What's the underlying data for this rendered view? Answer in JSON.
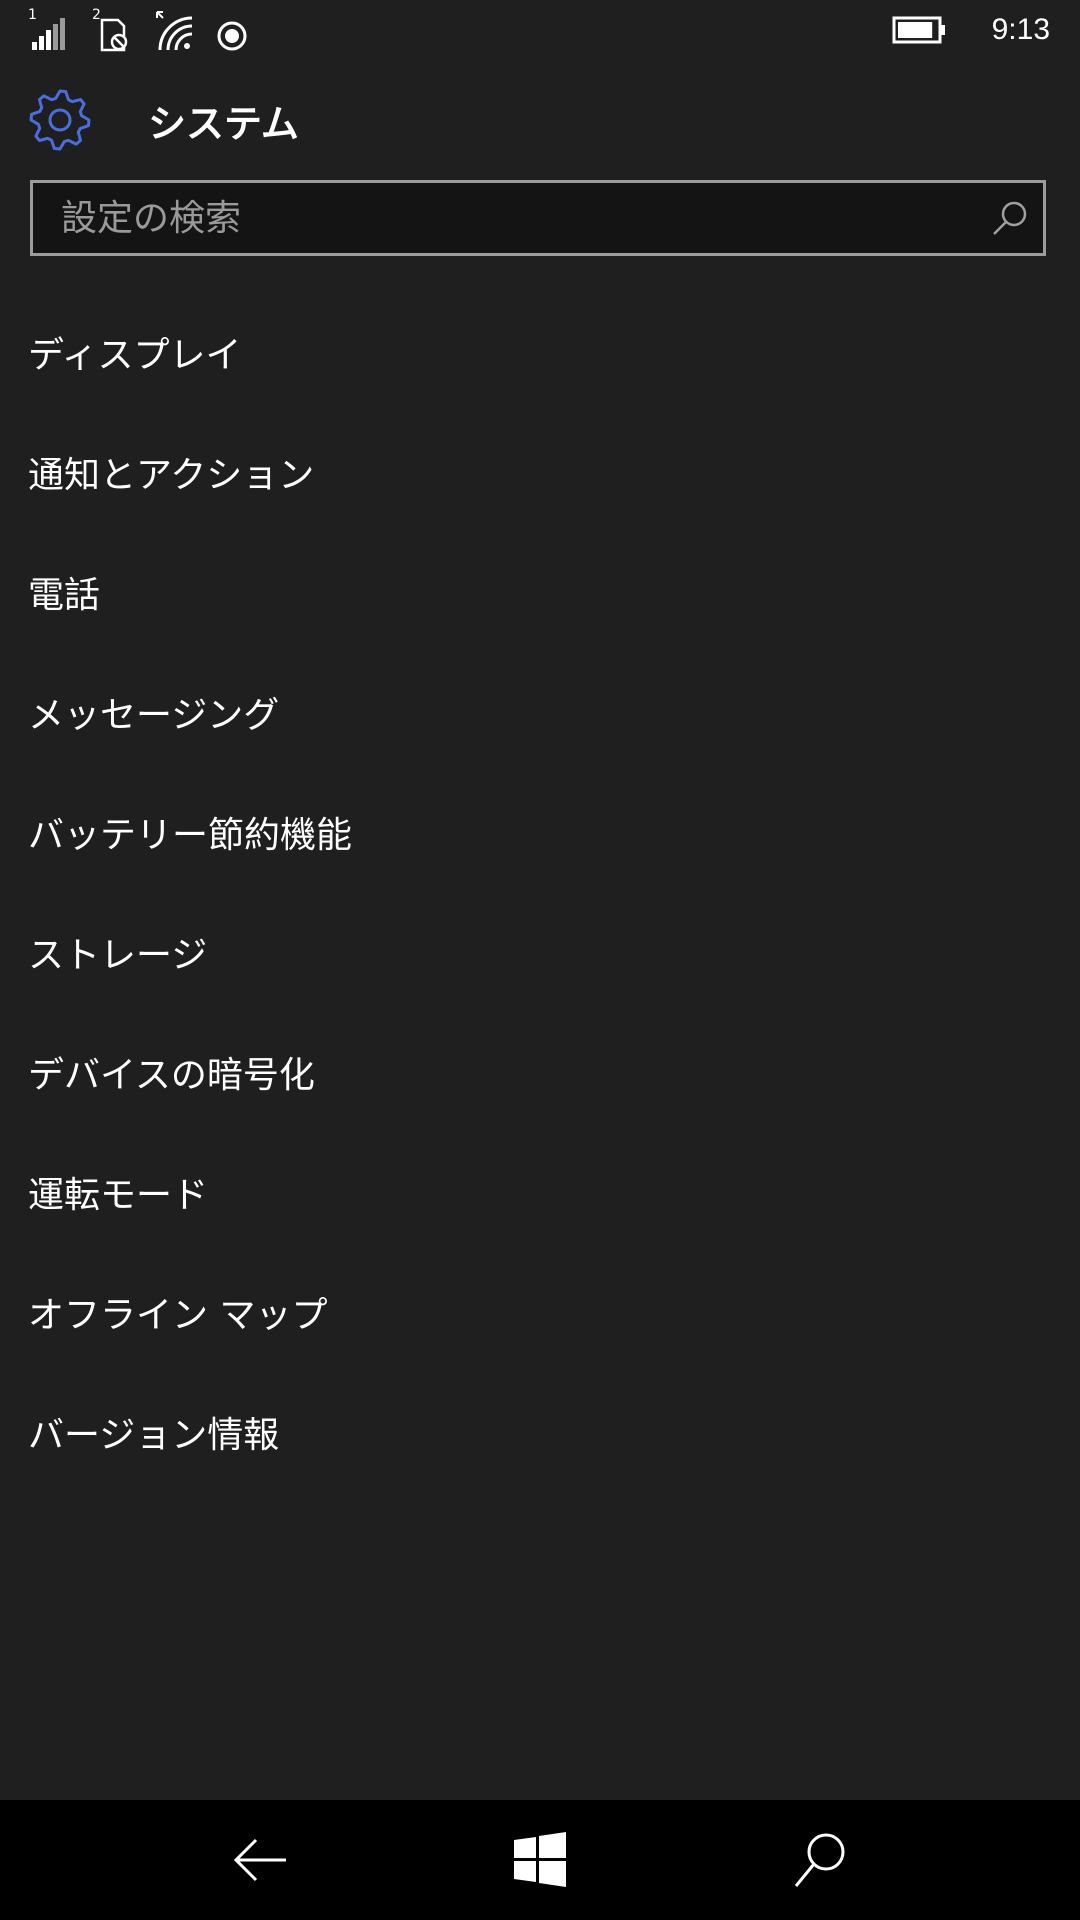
{
  "status_bar": {
    "sim1_label": "1",
    "sim2_label": "2",
    "time": "9:13",
    "battery_level": 0.9
  },
  "header": {
    "title": "システム",
    "accent_color": "#4a6ee0"
  },
  "search": {
    "placeholder": "設定の検索",
    "value": ""
  },
  "menu": {
    "items": [
      {
        "label": "ディスプレイ"
      },
      {
        "label": "通知とアクション"
      },
      {
        "label": "電話"
      },
      {
        "label": "メッセージング"
      },
      {
        "label": "バッテリー節約機能"
      },
      {
        "label": "ストレージ"
      },
      {
        "label": "デバイスの暗号化"
      },
      {
        "label": "運転モード"
      },
      {
        "label": "オフライン マップ"
      },
      {
        "label": "バージョン情報"
      }
    ]
  },
  "nav_bar": {
    "back_icon": "back-arrow-icon",
    "home_icon": "windows-logo-icon",
    "search_icon": "search-icon"
  }
}
